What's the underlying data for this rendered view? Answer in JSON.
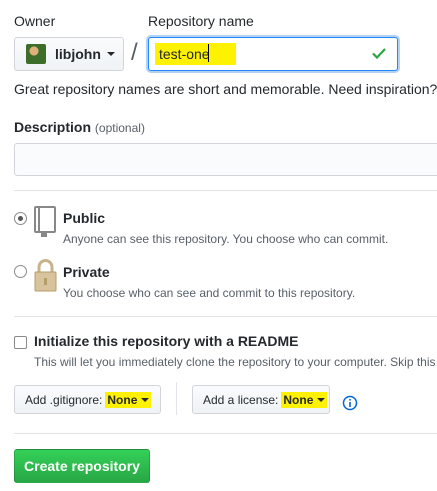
{
  "owner": {
    "label": "Owner",
    "name": "libjohn"
  },
  "repo": {
    "label": "Repository name",
    "value": "test-one"
  },
  "separator": "/",
  "hint": "Great repository names are short and memorable. Need inspiration?",
  "description": {
    "label": "Description",
    "optional": "(optional)",
    "value": ""
  },
  "visibility": {
    "public": {
      "title": "Public",
      "desc": "Anyone can see this repository. You choose who can commit.",
      "checked": true
    },
    "private": {
      "title": "Private",
      "desc": "You choose who can see and commit to this repository.",
      "checked": false
    }
  },
  "readme": {
    "title": "Initialize this repository with a README",
    "desc": "This will let you immediately clone the repository to your computer. Skip this",
    "checked": false
  },
  "gitignore": {
    "label": "Add .gitignore:",
    "value": "None"
  },
  "license": {
    "label": "Add a license:",
    "value": "None"
  },
  "create_button": "Create repository",
  "colors": {
    "accent_blue": "#0366d6",
    "green": "#28a745",
    "highlight": "#fff200"
  }
}
